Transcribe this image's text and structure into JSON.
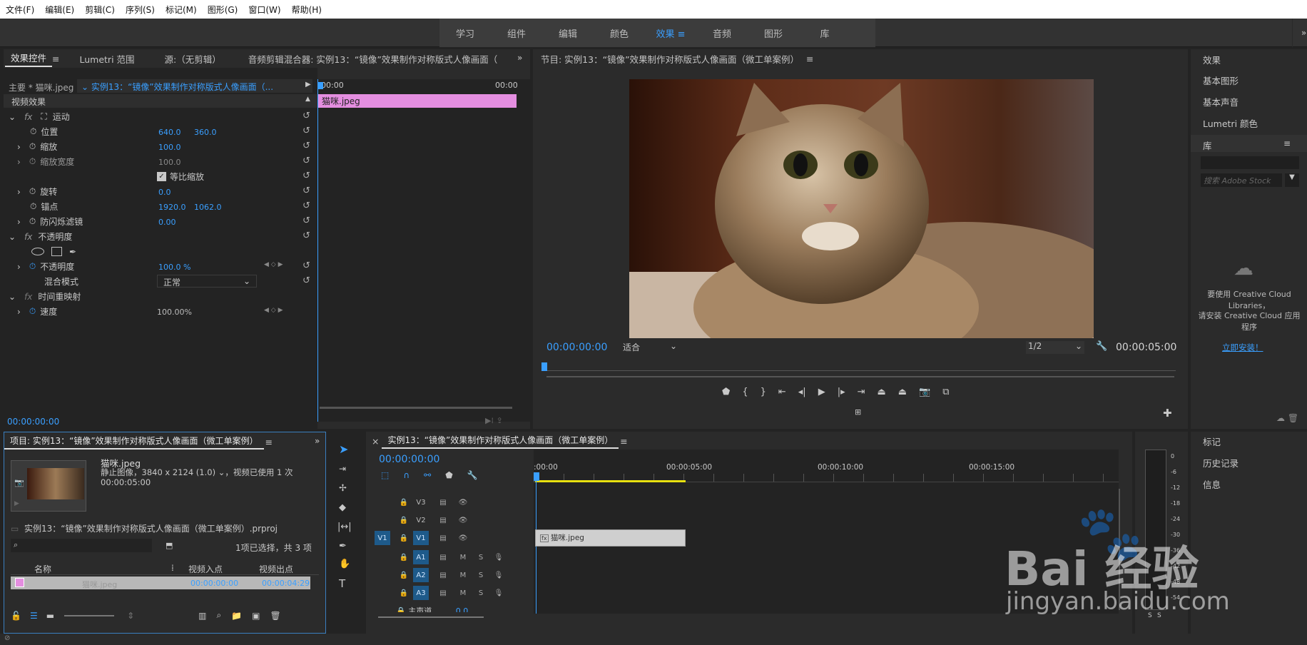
{
  "menu": [
    "文件(F)",
    "编辑(E)",
    "剪辑(C)",
    "序列(S)",
    "标记(M)",
    "图形(G)",
    "窗口(W)",
    "帮助(H)"
  ],
  "workspaces": {
    "items": [
      "学习",
      "组件",
      "编辑",
      "颜色",
      "效果",
      "音频",
      "图形",
      "库"
    ],
    "active": "效果",
    "more": "»"
  },
  "effect_controls": {
    "tabs": [
      "效果控件",
      "Lumetri 范围",
      "源:（无剪辑）",
      "音频剪辑混合器: 实例13：“镜像”效果制作对称版式人像画面（"
    ],
    "master": "主要 * 猫咪.jpeg",
    "sequence": "实例13：“镜像”效果制作对称版式人像画面（...",
    "ruler_start": "00:00",
    "ruler_end": "00:00",
    "clip_label": "猫咪.jpeg",
    "section": "视频效果",
    "motion": "运动",
    "position_label": "位置",
    "position_x": "640.0",
    "position_y": "360.0",
    "scale_label": "缩放",
    "scale": "100.0",
    "scale_width_label": "缩放宽度",
    "scale_width": "100.0",
    "uniform_label": "等比缩放",
    "rotation_label": "旋转",
    "rotation": "0.0",
    "anchor_label": "锚点",
    "anchor_x": "1920.0",
    "anchor_y": "1062.0",
    "flicker_label": "防闪烁滤镜",
    "flicker": "0.00",
    "opacity_group": "不透明度",
    "opacity_label": "不透明度",
    "opacity": "100.0 %",
    "blend_label": "混合模式",
    "blend": "正常",
    "time_remap": "时间重映射",
    "speed_label": "速度",
    "speed": "100.00%",
    "timecode": "00:00:00:00"
  },
  "program": {
    "title": "节目: 实例13：“镜像”效果制作对称版式人像画面（微工单案例）",
    "timecode": "00:00:00:00",
    "fit": "适合",
    "resolution": "1/2",
    "duration": "00:00:05:00"
  },
  "right_panel": {
    "items": [
      "效果",
      "基本图形",
      "基本声音",
      "Lumetri 颜色"
    ],
    "library_title": "库",
    "search_placeholder": "搜索 Adobe Stock",
    "cc_msg1": "要使用 Creative Cloud Libraries，",
    "cc_msg2": "请安装 Creative Cloud 应用程序",
    "install_link": "立即安装！",
    "bottom_items": [
      "标记",
      "历史记录",
      "信息"
    ]
  },
  "project": {
    "title": "项目: 实例13：“镜像”效果制作对称版式人像画面（微工单案例）",
    "file_name": "猫咪.jpeg",
    "file_info": "静止图像，3840 x 2124 (1.0)",
    "file_used": "，视频已使用 1 次",
    "file_duration": "00:00:05:00",
    "project_file": "实例13：“镜像”效果制作对称版式人像画面（微工单案例）.prproj",
    "selection": "1项已选择，共 3 项",
    "col_name": "名称",
    "col_in": "视频入点",
    "col_out": "视频出点",
    "row_name": "猫咪.jpeg",
    "row_in": "00:00:00:00",
    "row_out": "00:00:04:29"
  },
  "timeline": {
    "title": "实例13：“镜像”效果制作对称版式人像画面（微工单案例）",
    "timecode": "00:00:00:00",
    "ruler": [
      ":00:00",
      "00:00:05:00",
      "00:00:10:00",
      "00:00:15:00"
    ],
    "tracks": [
      "V3",
      "V2",
      "V1",
      "A1",
      "A2",
      "A3"
    ],
    "src_v": "V1",
    "master": "主声道",
    "master_val": "0.0",
    "clip": "猫咪.jpeg",
    "mute": "M",
    "solo": "S"
  },
  "meter": {
    "ticks": [
      "0",
      "-6",
      "-12",
      "-18",
      "-24",
      "-30",
      "-36",
      "-42",
      "-48",
      "-54"
    ],
    "solo": [
      "S",
      "S"
    ]
  },
  "watermark": {
    "text": "Bai  经验",
    "url": "jingyan.baidu.com"
  }
}
